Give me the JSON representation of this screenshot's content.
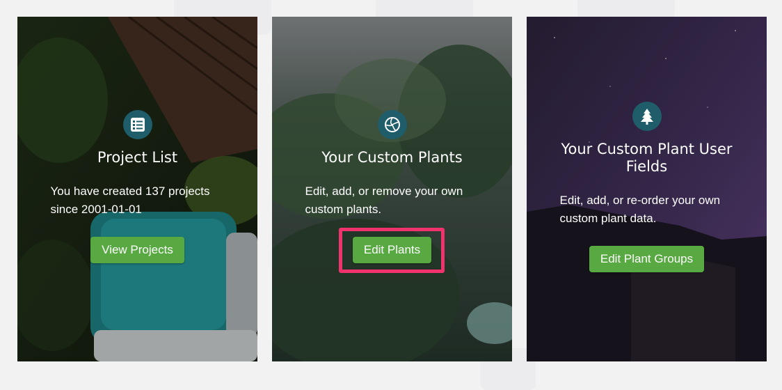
{
  "cards": [
    {
      "icon": "list-icon",
      "title": "Project List",
      "description": "You have created 137 projects since 2001-01-01",
      "button": "View Projects"
    },
    {
      "icon": "plant-cell-icon",
      "title": "Your Custom Plants",
      "description": "Edit, add, or remove your own custom plants.",
      "button": "Edit Plants"
    },
    {
      "icon": "tree-icon",
      "title": "Your Custom Plant User Fields",
      "description": "Edit, add, or re-order your own custom plant data.",
      "button": "Edit Plant Groups"
    }
  ],
  "colors": {
    "button": "#58a942",
    "icon_circle": "#1f5d6b",
    "highlight": "#f0336d"
  }
}
